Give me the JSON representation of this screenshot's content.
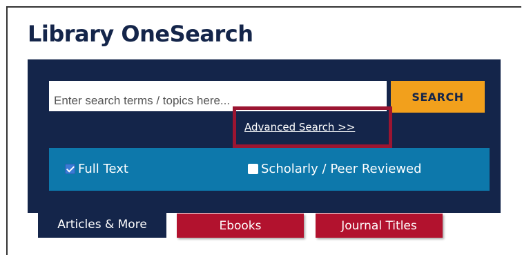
{
  "title": "Library OneSearch",
  "search": {
    "placeholder": "Enter search terms / topics here...",
    "value": "",
    "button_label": "SEARCH"
  },
  "advanced_search": {
    "label": "Advanced Search >>"
  },
  "filters": [
    {
      "label": "Full Text",
      "checked": true
    },
    {
      "label": "Scholarly / Peer Reviewed",
      "checked": false
    }
  ],
  "tabs": [
    {
      "label": "Articles & More",
      "active": true
    },
    {
      "label": "Ebooks",
      "active": false
    },
    {
      "label": "Journal Titles",
      "active": false
    }
  ],
  "colors": {
    "navy": "#14254a",
    "accent_orange": "#f2a01c",
    "filter_blue": "#0d78ab",
    "tab_red": "#b2122e",
    "highlight_red": "#9b1531"
  }
}
